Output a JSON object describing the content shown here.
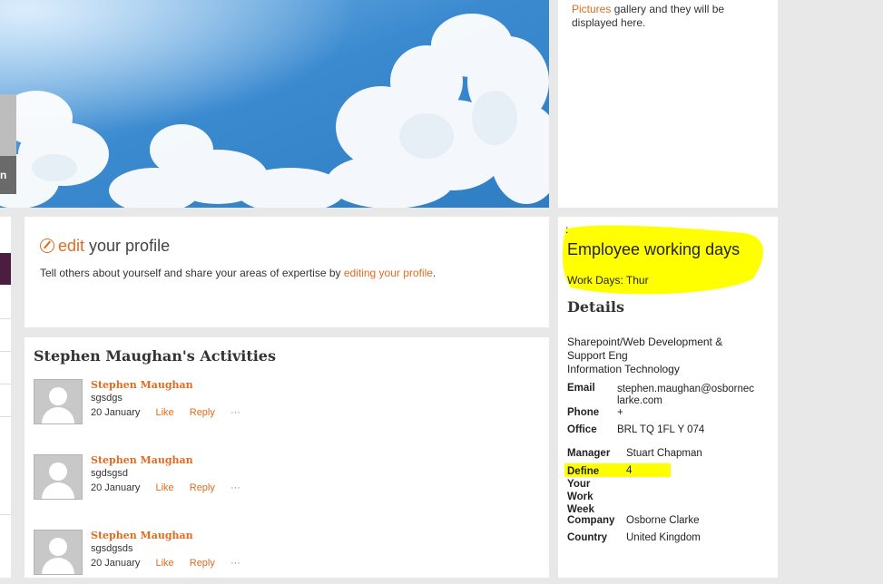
{
  "pictures_panel": {
    "link": "Pictures",
    "text_1": " gallery and they will be",
    "text_2": "displayed here."
  },
  "hero": {
    "tab_letter": "n"
  },
  "edit_profile": {
    "title_accent": "edit",
    "title_rest": " your profile",
    "description": "Tell others about yourself and share your areas of expertise by ",
    "link": "editing your profile",
    "period": "."
  },
  "activities": {
    "title": "Stephen Maughan's Activities",
    "items": [
      {
        "name": "Stephen Maughan",
        "message": "sgsdgs",
        "date": "20 January",
        "like": "Like",
        "reply": "Reply",
        "more": "···"
      },
      {
        "name": "Stephen Maughan",
        "message": "sgdsgsd",
        "date": "20 January",
        "like": "Like",
        "reply": "Reply",
        "more": "···"
      },
      {
        "name": "Stephen Maughan",
        "message": "sgsdgsds",
        "date": "20 January",
        "like": "Like",
        "reply": "Reply",
        "more": "···"
      }
    ]
  },
  "details": {
    "dot": ":",
    "working_days_title": "Employee working days",
    "work_days": "Work Days: Thur",
    "title": "Details",
    "department_1": "Sharepoint/Web Development &",
    "department_2": "Support Eng",
    "department_3": "Information Technology",
    "email_label": "Email",
    "email_1": "stephen.maughan@osbornec",
    "email_2": "larke.com",
    "phone_label": "Phone",
    "phone": "+",
    "office_label": "Office",
    "office": "BRL TQ 1FL Y 074",
    "manager_label": "Manager",
    "manager": "Stuart Chapman",
    "define_label_1": "Define",
    "define_label_2": "Your",
    "define_label_3": "Work",
    "define_label_4": "Week",
    "define_value": "4",
    "company_label": "Company",
    "company": "Osborne Clarke",
    "country_label": "Country",
    "country": "United Kingdom"
  },
  "colors": {
    "accent": "#e06c1f",
    "highlight": "#ffff00",
    "sky": "#3d86c7"
  }
}
